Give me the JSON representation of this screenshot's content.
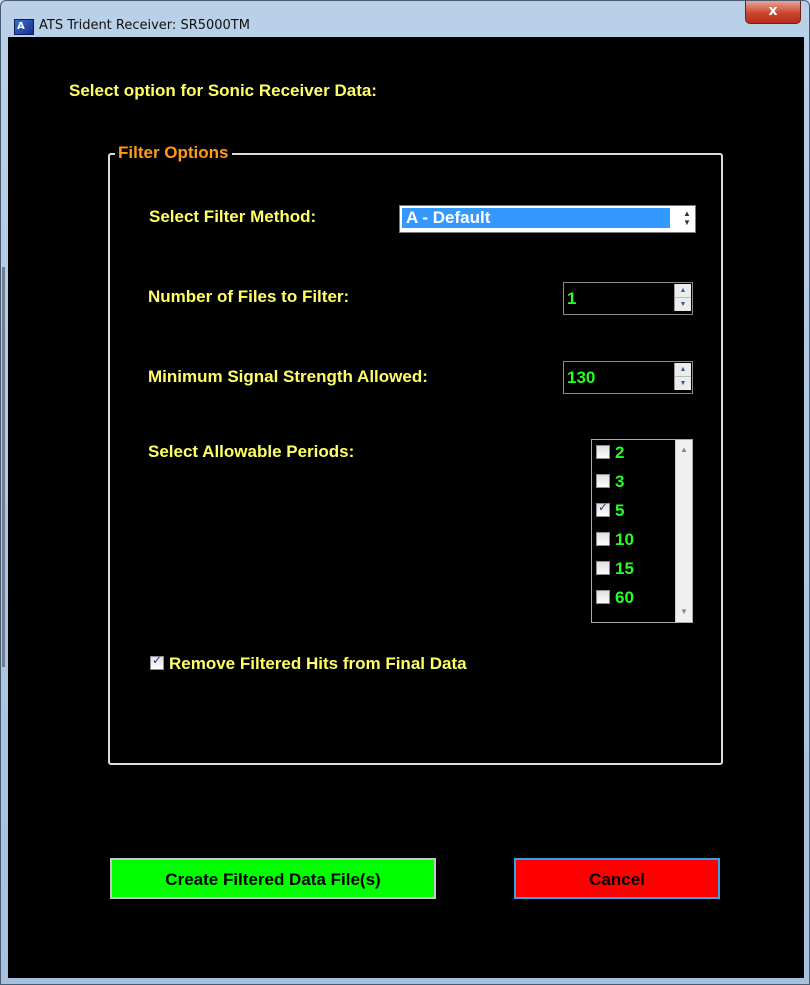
{
  "window": {
    "title": "ATS Trident Receiver: SR5000TM",
    "close_label": "x",
    "app_icon": "ats-logo-icon"
  },
  "heading": "Select option for Sonic Receiver Data:",
  "filter_group": {
    "legend": "Filter Options",
    "filter_method": {
      "label": "Select Filter Method:",
      "value": "A - Default"
    },
    "num_files": {
      "label": "Number of Files to Filter:",
      "value": "1"
    },
    "min_signal": {
      "label": "Minimum Signal Strength Allowed:",
      "value": "130"
    },
    "periods": {
      "label": "Select Allowable Periods:",
      "items": [
        {
          "label": "2",
          "checked": false
        },
        {
          "label": "3",
          "checked": false
        },
        {
          "label": "5",
          "checked": true
        },
        {
          "label": "10",
          "checked": false
        },
        {
          "label": "15",
          "checked": false
        },
        {
          "label": "60",
          "checked": false
        }
      ]
    },
    "remove_filtered": {
      "label": "Remove Filtered Hits from Final Data",
      "checked": true
    }
  },
  "buttons": {
    "create": "Create Filtered Data File(s)",
    "cancel": "Cancel"
  },
  "colors": {
    "label_yellow": "#ffff66",
    "legend_orange": "#ff9a1a",
    "value_green": "#22ff22",
    "create_button": "#00ff00",
    "cancel_button": "#ff0000",
    "combo_selection": "#3399ff"
  }
}
